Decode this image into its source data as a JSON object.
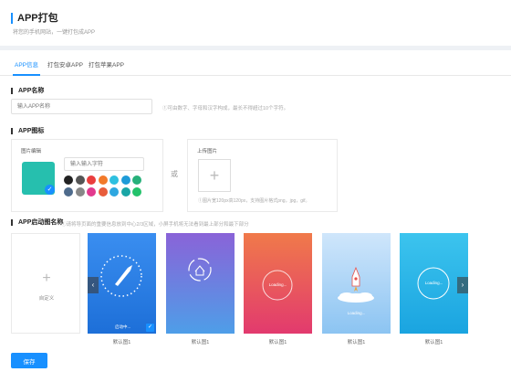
{
  "header": {
    "title": "APP打包",
    "subtitle": "将您的手机网站，一键打包成APP"
  },
  "tabs": [
    {
      "label": "APP信息"
    },
    {
      "label": "打包安卓APP"
    },
    {
      "label": "打包苹果APP"
    }
  ],
  "app_name": {
    "label": "APP名称",
    "placeholder": "输入APP名称",
    "hint": "①可由数字、字母和汉字构成，最长不得超过10个字符。"
  },
  "app_icon": {
    "label": "APP图标",
    "editor_title": "图片编辑",
    "text_placeholder": "输入输入字符",
    "or_label": "或",
    "upload_title": "上传图片",
    "upload_hint": "①图片宽120px高120px，支持图片格式png，jpg，gif。",
    "swatches": [
      "#222222",
      "#555555",
      "#ea3e3e",
      "#f27a2a",
      "#2ec0e0",
      "#1e9bd8",
      "#27b07a",
      "#4e6b8c",
      "#888888",
      "#e23a8e",
      "#e85d3c",
      "#2ea7e0",
      "#1aa6a6",
      "#23c26b"
    ]
  },
  "launch": {
    "label": "APP启动图名称",
    "hint": "①请将导页面的重要信息放到中心2/3区域，小屏手机将无法看到最上部分和最下部分",
    "custom_label": "自定义",
    "thumbs": [
      {
        "caption": "默认图1",
        "text": "启动中..."
      },
      {
        "caption": "默认图1",
        "text": ""
      },
      {
        "caption": "默认图1",
        "text": "Loading..."
      },
      {
        "caption": "默认图1",
        "text": "Loading..."
      },
      {
        "caption": "默认图1",
        "text": "Loading..."
      }
    ]
  },
  "save_label": "保存",
  "colors": {
    "accent": "#1890ff",
    "icon_preview": "#26bfae"
  }
}
